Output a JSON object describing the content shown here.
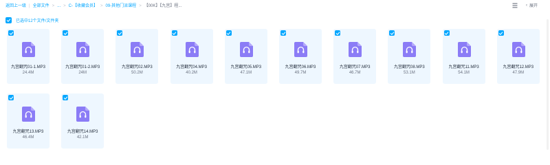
{
  "breadcrumb": {
    "items": [
      "返回上一级",
      "全部文件",
      "...",
      "C-【收藏会员】",
      "09-其他门派课程",
      "【00K】【九宫】程..."
    ],
    "separator": "|",
    "arrow": ">"
  },
  "toolbar": {
    "expand_label": "展开"
  },
  "selection": {
    "text": "已选中12个文件/文件夹"
  },
  "colors": {
    "accent": "#06a7ff",
    "card_bg": "#eef7ff",
    "audio_icon": "#8b7cf6"
  },
  "files": [
    {
      "name": "九宫翻咒01-1.MP3",
      "size": "24.4M",
      "icon": "audio-file-icon"
    },
    {
      "name": "九宫翻咒01-2.MP3",
      "size": "24M",
      "icon": "audio-file-icon"
    },
    {
      "name": "九宫翻咒02.MP3",
      "size": "50.2M",
      "icon": "audio-file-icon"
    },
    {
      "name": "九宫翻咒04.MP3",
      "size": "40.2M",
      "icon": "audio-file-icon"
    },
    {
      "name": "九宫翻咒05.MP3",
      "size": "47.1M",
      "icon": "audio-file-icon"
    },
    {
      "name": "九宫翻咒06.MP3",
      "size": "49.7M",
      "icon": "audio-file-icon"
    },
    {
      "name": "九宫翻咒07.MP3",
      "size": "46.7M",
      "icon": "audio-file-icon"
    },
    {
      "name": "九宫翻咒08.MP3",
      "size": "53.1M",
      "icon": "audio-file-icon"
    },
    {
      "name": "九宫翻咒11.MP3",
      "size": "54.1M",
      "icon": "audio-file-icon"
    },
    {
      "name": "九宫翻咒12.MP3",
      "size": "47.9M",
      "icon": "audio-file-icon"
    },
    {
      "name": "九宫翻咒13.MP3",
      "size": "46.4M",
      "icon": "audio-file-icon"
    },
    {
      "name": "九宫翻咒14.MP3",
      "size": "42.1M",
      "icon": "audio-file-icon"
    }
  ]
}
